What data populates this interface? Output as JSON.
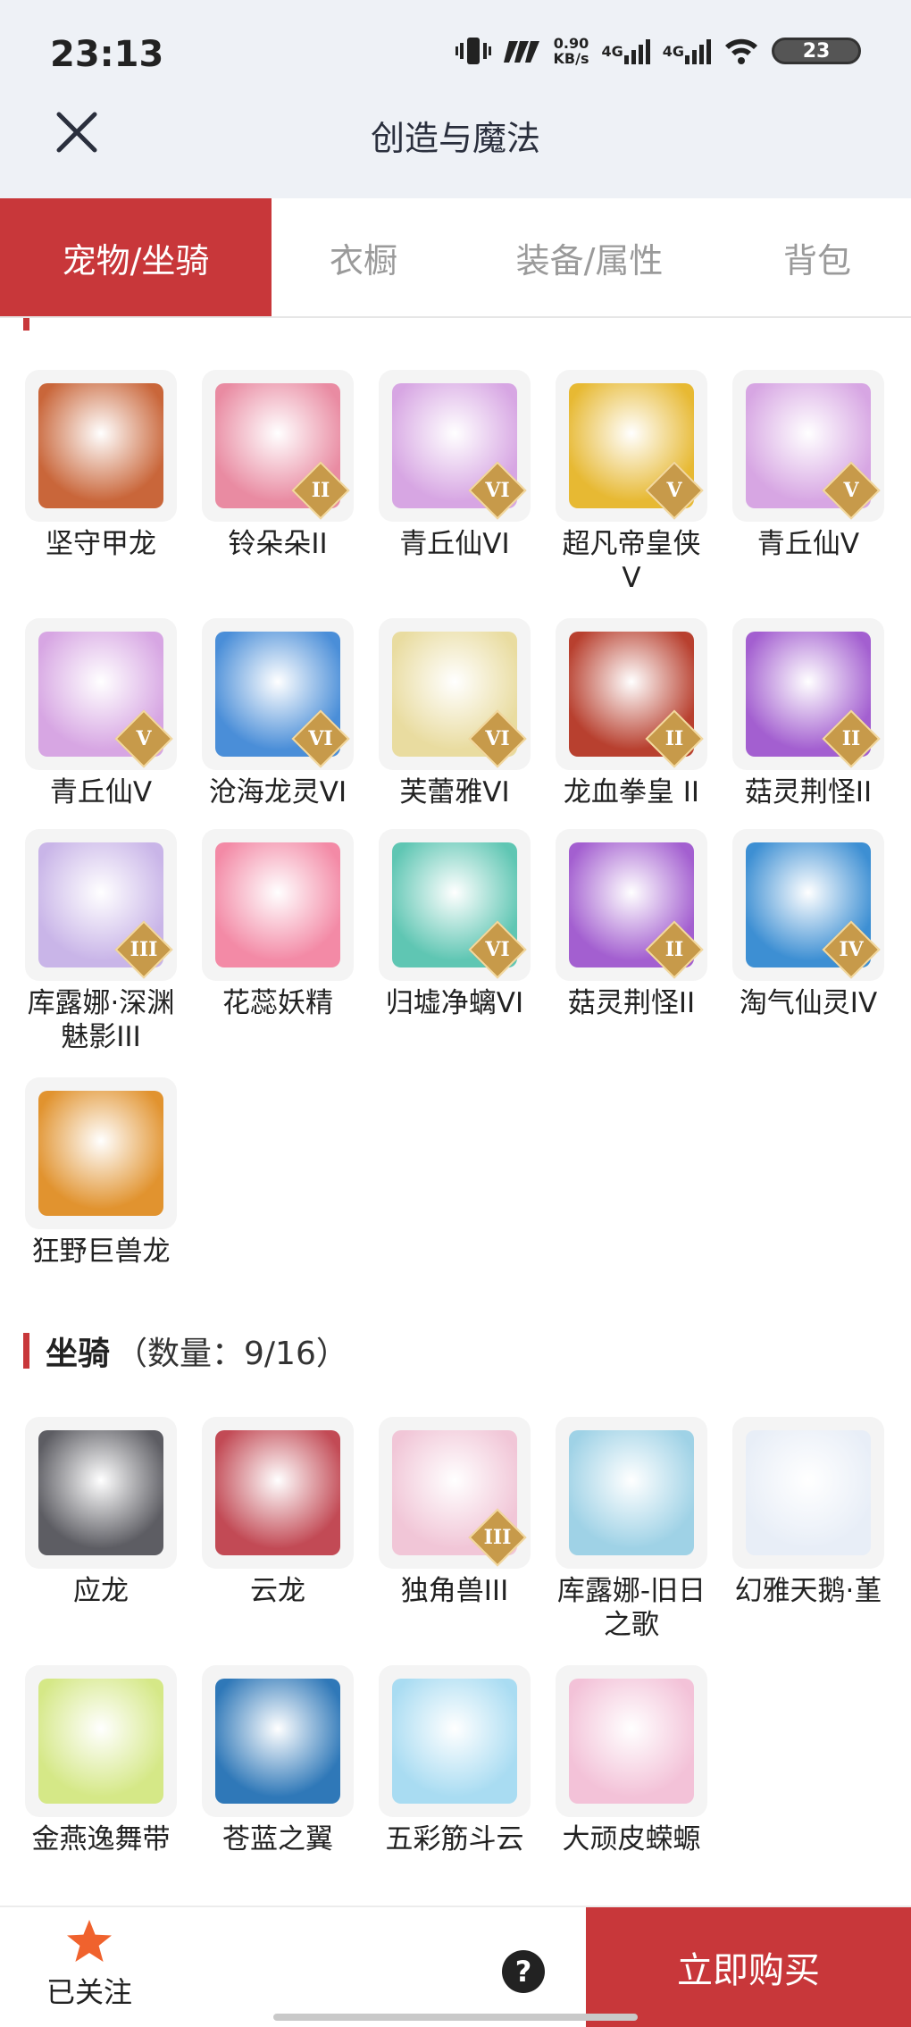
{
  "status_bar": {
    "time": "23:13",
    "speed_value": "0.90",
    "speed_unit": "KB/s",
    "network_1": "4G",
    "network_2": "4G",
    "battery": "23"
  },
  "header": {
    "title": "创造与魔法"
  },
  "tabs": [
    {
      "label": "宠物/坐骑",
      "active": true
    },
    {
      "label": "衣橱",
      "active": false
    },
    {
      "label": "装备/属性",
      "active": false
    },
    {
      "label": "背包",
      "active": false
    }
  ],
  "pets": [
    {
      "name": "坚守甲龙",
      "icon": "dragon-pet-icon",
      "color": "#c9663a",
      "badge": ""
    },
    {
      "name": "铃朵朵II",
      "icon": "flower-fairy-pet-icon",
      "color": "#e98ba2",
      "badge": "II"
    },
    {
      "name": "青丘仙VI",
      "icon": "fox-fairy-pet-icon",
      "color": "#d7a6e3",
      "badge": "VI"
    },
    {
      "name": "超凡帝皇侠V",
      "icon": "golden-knight-pet-icon",
      "color": "#e7b933",
      "badge": "V"
    },
    {
      "name": "青丘仙V",
      "icon": "fox-fairy-pet-icon",
      "color": "#d7a6e3",
      "badge": "V"
    },
    {
      "name": "青丘仙V",
      "icon": "fox-fairy-pet-icon",
      "color": "#d7a6e3",
      "badge": "V"
    },
    {
      "name": "沧海龙灵VI",
      "icon": "sea-dragon-spirit-pet-icon",
      "color": "#4a8ed8",
      "badge": "VI"
    },
    {
      "name": "芙蕾雅VI",
      "icon": "freya-pet-icon",
      "color": "#e9dca0",
      "badge": "VI"
    },
    {
      "name": "龙血拳皇 II",
      "icon": "dragon-fist-pet-icon",
      "color": "#b8402f",
      "badge": "II"
    },
    {
      "name": "菇灵荆怪II",
      "icon": "mushroom-imp-pet-icon",
      "color": "#a35fd0",
      "badge": "II"
    },
    {
      "name": "库露娜·深渊魅影III",
      "icon": "kuluna-pet-icon",
      "color": "#c9b5e8",
      "badge": "III"
    },
    {
      "name": "花蕊妖精",
      "icon": "flower-sprite-pet-icon",
      "color": "#f38aa6",
      "badge": ""
    },
    {
      "name": "归墟净螭VI",
      "icon": "jade-dragon-pet-icon",
      "color": "#5fc6b3",
      "badge": "VI"
    },
    {
      "name": "菇灵荆怪II",
      "icon": "mushroom-imp-pet-icon",
      "color": "#a35fd0",
      "badge": "II"
    },
    {
      "name": "淘气仙灵IV",
      "icon": "blue-puppy-pet-icon",
      "color": "#3d8fd3",
      "badge": "IV"
    },
    {
      "name": "狂野巨兽龙",
      "icon": "wild-beast-dragon-pet-icon",
      "color": "#e1932f",
      "badge": ""
    }
  ],
  "mounts_section": {
    "name": "坐骑",
    "count": "（数量：9/16）"
  },
  "mounts": [
    {
      "name": "应龙",
      "icon": "ying-dragon-mount-icon",
      "color": "#5d5d63",
      "badge": ""
    },
    {
      "name": "云龙",
      "icon": "cloud-dragon-mount-icon",
      "color": "#c24a55",
      "badge": ""
    },
    {
      "name": "独角兽III",
      "icon": "unicorn-mount-icon",
      "color": "#f1c6d7",
      "badge": "III"
    },
    {
      "name": "库露娜-旧日之歌",
      "icon": "kuluna-mount-icon",
      "color": "#9fd2e6",
      "badge": ""
    },
    {
      "name": "幻雅天鹅·堇",
      "icon": "swan-mount-icon",
      "color": "#e8eef7",
      "badge": ""
    },
    {
      "name": "金燕逸舞带",
      "icon": "golden-swallow-ribbon-mount-icon",
      "color": "#d5e887",
      "badge": ""
    },
    {
      "name": "苍蓝之翼",
      "icon": "azure-wing-mount-icon",
      "color": "#2f78b8",
      "badge": ""
    },
    {
      "name": "五彩筋斗云",
      "icon": "somersault-cloud-mount-icon",
      "color": "#a9dcf2",
      "badge": ""
    },
    {
      "name": "大顽皮蝾螈",
      "icon": "axolotl-mount-icon",
      "color": "#f3c2d8",
      "badge": ""
    }
  ],
  "bottom_bar": {
    "follow_label": "已关注",
    "help_glyph": "?",
    "buy_label": "立即购买"
  }
}
